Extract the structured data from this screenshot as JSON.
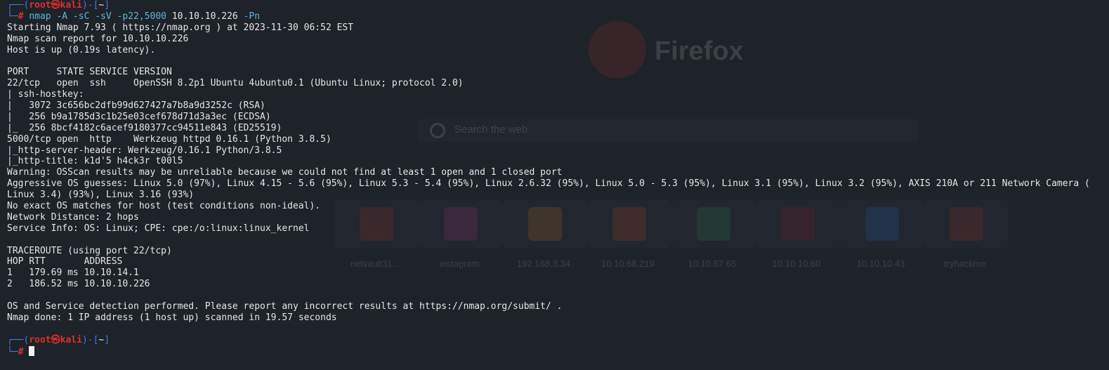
{
  "background_page": {
    "brand": "Firefox",
    "search_placeholder": "Search the web",
    "shortcuts": [
      {
        "label": "netvault31...",
        "color": "#c0392b"
      },
      {
        "label": "instagram",
        "color": "#b93f8a"
      },
      {
        "label": "192.168.3.34",
        "color": "#e08a1e"
      },
      {
        "label": "10.10.68.219",
        "color": "#e0501e"
      },
      {
        "label": "10.10.67.65",
        "color": "#1e9e5a"
      },
      {
        "label": "10.10.10.60",
        "color": "#a01e2a"
      },
      {
        "label": "10.10.10.43",
        "color": "#1e7ae0"
      },
      {
        "label": "tryhackme",
        "color": "#c0392b"
      }
    ]
  },
  "prompt": {
    "top_prefix": "┌──(",
    "user_host": "root㉿kali",
    "dir_sep": ")-[",
    "dir": "~",
    "dir_close": "]",
    "bottom_prefix": "└─",
    "hash": "#"
  },
  "command": {
    "name": "nmap",
    "flags": "-A -sC -sV -p22,5000",
    "target": "10.10.10.226",
    "tail": "-Pn"
  },
  "output": [
    "Starting Nmap 7.93 ( https://nmap.org ) at 2023-11-30 06:52 EST",
    "Nmap scan report for 10.10.10.226",
    "Host is up (0.19s latency).",
    "",
    "PORT     STATE SERVICE VERSION",
    "22/tcp   open  ssh     OpenSSH 8.2p1 Ubuntu 4ubuntu0.1 (Ubuntu Linux; protocol 2.0)",
    "| ssh-hostkey:",
    "|   3072 3c656bc2dfb99d627427a7b8a9d3252c (RSA)",
    "|   256 b9a1785d3c1b25e03cef678d71d3a3ec (ECDSA)",
    "|_  256 8bcf4182c6acef9180377cc94511e843 (ED25519)",
    "5000/tcp open  http    Werkzeug httpd 0.16.1 (Python 3.8.5)",
    "|_http-server-header: Werkzeug/0.16.1 Python/3.8.5",
    "|_http-title: k1d'5 h4ck3r t00l5",
    "Warning: OSScan results may be unreliable because we could not find at least 1 open and 1 closed port",
    "Aggressive OS guesses: Linux 5.0 (97%), Linux 4.15 - 5.6 (95%), Linux 5.3 - 5.4 (95%), Linux 2.6.32 (95%), Linux 5.0 - 5.3 (95%), Linux 3.1 (95%), Linux 3.2 (95%), AXIS 210A or 211 Network Camera (",
    "Linux 3.4) (93%), Linux 3.16 (93%)",
    "No exact OS matches for host (test conditions non-ideal).",
    "Network Distance: 2 hops",
    "Service Info: OS: Linux; CPE: cpe:/o:linux:linux_kernel",
    "",
    "TRACEROUTE (using port 22/tcp)",
    "HOP RTT       ADDRESS",
    "1   179.69 ms 10.10.14.1",
    "2   186.52 ms 10.10.10.226",
    "",
    "OS and Service detection performed. Please report any incorrect results at https://nmap.org/submit/ .",
    "Nmap done: 1 IP address (1 host up) scanned in 19.57 seconds",
    ""
  ]
}
